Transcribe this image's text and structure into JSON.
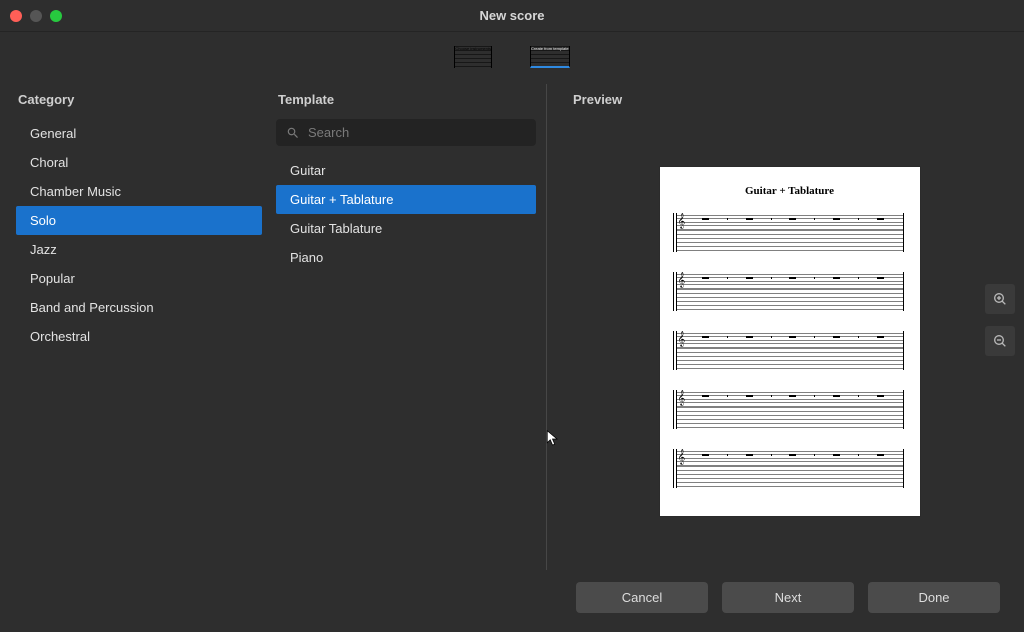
{
  "window": {
    "title": "New score"
  },
  "tabs": {
    "choose": "Choose instruments",
    "create": "Create from template"
  },
  "headings": {
    "category": "Category",
    "template": "Template",
    "preview": "Preview"
  },
  "categories": [
    {
      "label": "General",
      "selected": false
    },
    {
      "label": "Choral",
      "selected": false
    },
    {
      "label": "Chamber Music",
      "selected": false
    },
    {
      "label": "Solo",
      "selected": true
    },
    {
      "label": "Jazz",
      "selected": false
    },
    {
      "label": "Popular",
      "selected": false
    },
    {
      "label": "Band and Percussion",
      "selected": false
    },
    {
      "label": "Orchestral",
      "selected": false
    }
  ],
  "search": {
    "placeholder": "Search"
  },
  "templates": [
    {
      "label": "Guitar",
      "selected": false
    },
    {
      "label": "Guitar + Tablature",
      "selected": true
    },
    {
      "label": "Guitar Tablature",
      "selected": false
    },
    {
      "label": "Piano",
      "selected": false
    }
  ],
  "preview": {
    "page_title": "Guitar + Tablature"
  },
  "buttons": {
    "cancel": "Cancel",
    "next": "Next",
    "done": "Done"
  }
}
